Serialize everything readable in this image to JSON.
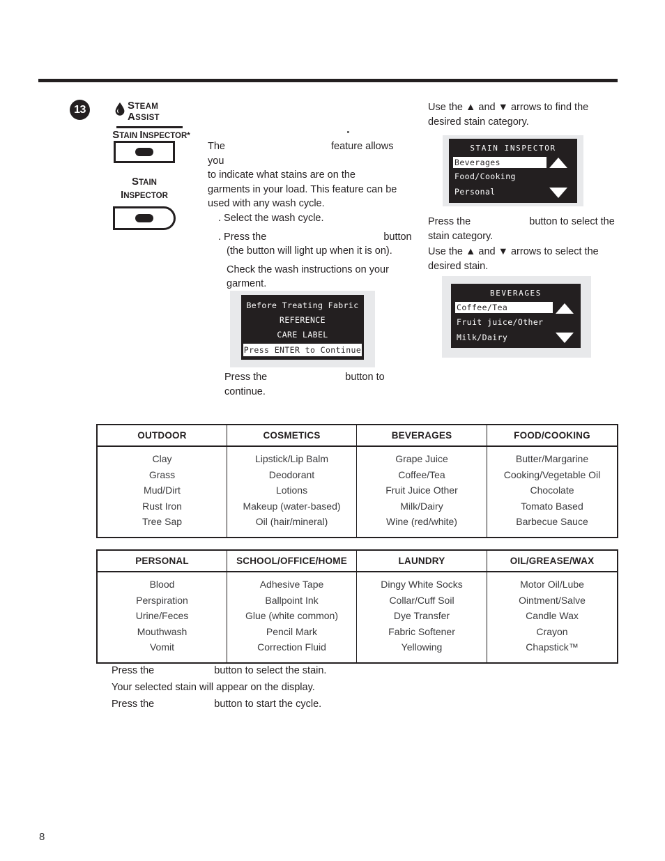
{
  "page": {
    "number": "8",
    "step_number": "13"
  },
  "panel": {
    "steam_word": "Steam",
    "assist_word": "Assist",
    "drop_icon": "water-drop-icon",
    "stain_inspector_sub": "Stain Inspector*",
    "stain_inspector_label_line1": "Stain",
    "stain_inspector_label_line2": "Inspector"
  },
  "intro": {
    "line1_pre": "The",
    "line1_post": "feature allows you",
    "line2": "to indicate what stains are on the",
    "line3": "garments in your load. This feature can be",
    "line4": "used with any wash cycle."
  },
  "steps": {
    "step1": ". Select the wash cycle.",
    "step2_pre": ". Press the",
    "step2_post": "button",
    "step2_note": "(the button will light up when it is on).",
    "step2_sub1": "Check the wash instructions on your",
    "step2_sub2": "garment."
  },
  "press_continue": {
    "pre": "Press the",
    "post": "button to continue."
  },
  "right_column": {
    "copy1_line1": "Use the ▲ and ▼ arrows to find the",
    "copy1_line2": "desired stain category.",
    "copy2_pre": "Press the",
    "copy2_post": "button to select the",
    "copy2_line2": "stain category.",
    "copy3_line1": "Use the ▲ and ▼ arrows to select the",
    "copy3_line2": "desired stain."
  },
  "displays": {
    "care_label": {
      "line1": "Before Treating Fabric",
      "line2": "REFERENCE",
      "line3": "CARE LABEL",
      "line4": "Press ENTER to Continue"
    },
    "category_menu": {
      "title": "STAIN INSPECTOR",
      "item1": "Beverages",
      "item2": "Food/Cooking",
      "item3": "Personal",
      "up_arrow": "scroll-up-arrow-icon",
      "down_arrow": "scroll-down-arrow-icon"
    },
    "beverages_menu": {
      "title": "BEVERAGES",
      "item1": "Coffee/Tea",
      "item2": "Fruit juice/Other",
      "item3": "Milk/Dairy",
      "up_arrow": "scroll-up-arrow-icon",
      "down_arrow": "scroll-down-arrow-icon"
    }
  },
  "tables": [
    {
      "id": "table-a",
      "columns": [
        {
          "header": "OUTDOOR",
          "items": [
            "Clay",
            "Grass",
            "Mud/Dirt",
            "Rust Iron",
            "Tree Sap"
          ]
        },
        {
          "header": "COSMETICS",
          "items": [
            "Lipstick/Lip Balm",
            "Deodorant",
            "Lotions",
            "Makeup (water-based)",
            "Oil (hair/mineral)"
          ]
        },
        {
          "header": "BEVERAGES",
          "items": [
            "Grape Juice",
            "Coffee/Tea",
            "Fruit Juice Other",
            "Milk/Dairy",
            "Wine (red/white)"
          ]
        },
        {
          "header": "FOOD/COOKING",
          "items": [
            "Butter/Margarine",
            "Cooking/Vegetable Oil",
            "Chocolate",
            "Tomato Based",
            "Barbecue Sauce"
          ]
        }
      ]
    },
    {
      "id": "table-b",
      "columns": [
        {
          "header": "PERSONAL",
          "items": [
            "Blood",
            "Perspiration",
            "Urine/Feces",
            "Mouthwash",
            "Vomit"
          ]
        },
        {
          "header": "SCHOOL/OFFICE/HOME",
          "items": [
            "Adhesive Tape",
            "Ballpoint Ink",
            "Glue (white common)",
            "Pencil Mark",
            "Correction Fluid"
          ]
        },
        {
          "header": "LAUNDRY",
          "items": [
            "Dingy White Socks",
            "Collar/Cuff Soil",
            "Dye Transfer",
            "Fabric Softener",
            "Yellowing"
          ]
        },
        {
          "header": "OIL/GREASE/WAX",
          "items": [
            "Motor Oil/Lube",
            "Ointment/Salve",
            "Candle Wax",
            "Crayon",
            "Chapstick™"
          ]
        }
      ]
    }
  ],
  "closing": {
    "line1_pre": "Press the",
    "line1_post": "button to select the stain.",
    "line2": "Your selected stain will appear on the display.",
    "line3_pre": "Press the",
    "line3_post": "button to start the cycle."
  }
}
